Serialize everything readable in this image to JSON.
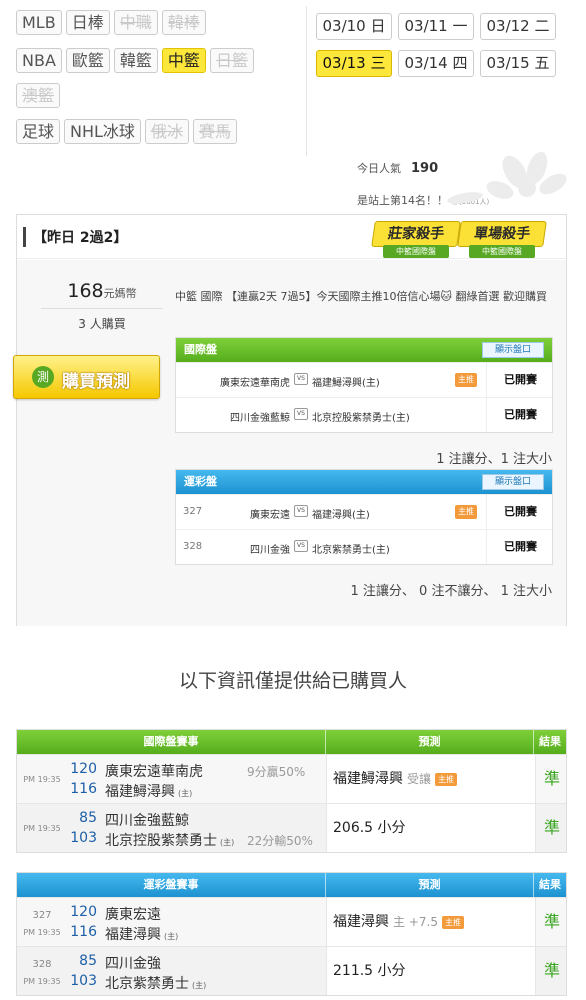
{
  "sports": {
    "row1": [
      {
        "label": "MLB",
        "state": "normal"
      },
      {
        "label": "日棒",
        "state": "normal"
      },
      {
        "label": "中職",
        "state": "disabled"
      },
      {
        "label": "韓棒",
        "state": "disabled"
      }
    ],
    "row2": [
      {
        "label": "NBA",
        "state": "normal"
      },
      {
        "label": "歐籃",
        "state": "normal"
      },
      {
        "label": "韓籃",
        "state": "normal"
      },
      {
        "label": "中籃",
        "state": "active"
      },
      {
        "label": "日籃",
        "state": "disabled"
      }
    ],
    "row3": [
      {
        "label": "澳籃",
        "state": "disabled"
      }
    ],
    "row4": [
      {
        "label": "足球",
        "state": "normal"
      },
      {
        "label": "NHL冰球",
        "state": "normal"
      },
      {
        "label": "俄冰",
        "state": "disabled"
      },
      {
        "label": "賽馬",
        "state": "disabled"
      }
    ]
  },
  "dates": {
    "row1": [
      {
        "label": "03/10 日",
        "active": false
      },
      {
        "label": "03/11 一",
        "active": false
      },
      {
        "label": "03/12 二",
        "active": false
      }
    ],
    "row2": [
      {
        "label": "03/13 三",
        "active": true
      },
      {
        "label": "03/14 四",
        "active": false
      },
      {
        "label": "03/15 五",
        "active": false
      }
    ]
  },
  "stats": {
    "popularity_label": "今日人氣",
    "popularity_value": "190",
    "rank_text": "是站上第14名！！",
    "rank_note": "(共3601人)"
  },
  "card": {
    "title": "【昨日 2過2】",
    "badges": [
      {
        "main": "莊家殺手",
        "sub": "中籃國際盤"
      },
      {
        "main": "單場殺手",
        "sub": "中籃國際盤"
      }
    ],
    "price": "168",
    "price_unit": "元媽幣",
    "buyers": "3 人購買",
    "buy_button": "購買預測",
    "buy_icon": "測",
    "description": "中籃 國際 【連贏2天 7過5】今天國際主推10倍信心場🐱 翻綠首選 歡迎購買",
    "intl": {
      "title": "國際盤",
      "show_button": "顯示盤口",
      "rows": [
        {
          "num": "",
          "home": "廣東宏遠華南虎",
          "away": "福建鱘潯興(主)",
          "mz": "主推",
          "status": "已開賽"
        },
        {
          "num": "",
          "home": "四川金強藍鯨",
          "away": "北京控股紫禁勇士(主)",
          "mz": "",
          "status": "已開賽"
        }
      ],
      "summary": "1 注讓分、1 注大小"
    },
    "lottery": {
      "title": "運彩盤",
      "show_button": "顯示盤口",
      "rows": [
        {
          "num": "327",
          "home": "廣東宏遠",
          "away": "福建潯興(主)",
          "mz": "主推",
          "status": "已開賽"
        },
        {
          "num": "328",
          "home": "四川金強",
          "away": "北京紫禁勇士(主)",
          "mz": "",
          "status": "已開賽"
        }
      ],
      "summary": "1 注讓分、 0 注不讓分、 1 注大小"
    }
  },
  "notice": "以下資訊僅提供給已購買人",
  "intl_table": {
    "headers": [
      "國際盤賽事",
      "預測",
      "結果"
    ],
    "rows": [
      {
        "time": "PM 19:35",
        "n1": "120",
        "n2": "116",
        "t1": "廣東宏遠華南虎",
        "t2": "福建鱘潯興",
        "t2_tag": "(主)",
        "t1_tag": "",
        "r1": "9分贏50%",
        "r2": "",
        "pred": "福建鱘潯興",
        "pred_note": "受讓",
        "pred_mz": "主推",
        "result": "準"
      },
      {
        "time": "PM 19:35",
        "n1": "85",
        "n2": "103",
        "t1": "四川金強藍鯨",
        "t2": "北京控股紫禁勇士",
        "t2_tag": "(主)",
        "t1_tag": "",
        "r1": "",
        "r2": "22分輸50%",
        "pred": "206.5 小分",
        "pred_note": "",
        "pred_mz": "",
        "result": "準"
      }
    ]
  },
  "lottery_table": {
    "headers": [
      "運彩盤賽事",
      "預測",
      "結果"
    ],
    "rows": [
      {
        "gid": "327",
        "time": "PM 19:35",
        "n1": "120",
        "n2": "116",
        "t1": "廣東宏遠",
        "t2": "福建潯興",
        "t2_tag": "(主)",
        "pred": "福建潯興",
        "pred_note": "主 +7.5",
        "pred_mz": "主推",
        "result": "準"
      },
      {
        "gid": "328",
        "time": "PM 19:35",
        "n1": "85",
        "n2": "103",
        "t1": "四川金強",
        "t2": "北京紫禁勇士",
        "t2_tag": "(主)",
        "pred": "211.5 小分",
        "pred_note": "",
        "pred_mz": "",
        "result": "準"
      }
    ]
  },
  "colors": {
    "accent_yellow": "#fce73a",
    "green": "#55ad1c",
    "blue": "#1c92d1",
    "win_green": "#3aa520",
    "orange": "#f39a3b"
  }
}
